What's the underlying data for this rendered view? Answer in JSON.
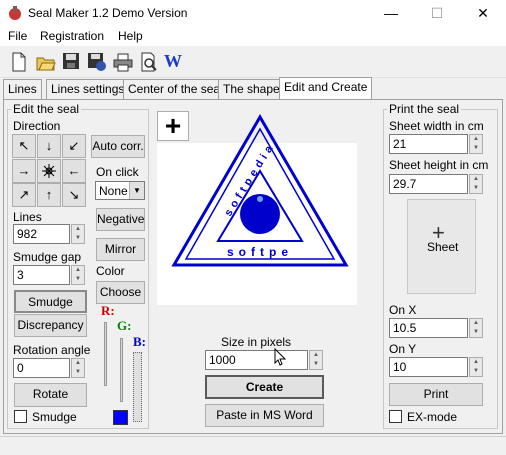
{
  "window": {
    "title": "Seal Maker 1.2 Demo Version",
    "minimize": "—",
    "maximize": "☐",
    "close": "✕"
  },
  "menu": [
    "File",
    "Registration",
    "Help"
  ],
  "toolbar": {
    "w_label": "W"
  },
  "tabs": [
    "Lines",
    "Lines settings",
    "Center of the seal",
    "The shape",
    "Edit and Create"
  ],
  "edit": {
    "group_title": "Edit the seal",
    "direction_label": "Direction",
    "auto_corr": "Auto corr.",
    "on_click_label": "On click",
    "on_click_value": "None",
    "lines_label": "Lines",
    "lines_value": "982",
    "negative": "Negative",
    "mirror": "Mirror",
    "smudge_gap_label": "Smudge gap",
    "smudge_gap_value": "3",
    "color_label": "Color",
    "choose": "Choose",
    "smudge_btn": "Smudge",
    "discrepancy": "Discrepancy",
    "r_label": "R:",
    "g_label": "G:",
    "b_label": "B:",
    "rotation_label": "Rotation angle",
    "rotation_value": "0",
    "rotate": "Rotate",
    "smudge_check": "Smudge",
    "color_swatch": "#0000ff"
  },
  "center": {
    "plus": "+",
    "seal_text_outer": "softpedia",
    "seal_text_inner": "softpe",
    "seal_color": "#0000cc",
    "size_label": "Size in pixels",
    "size_value": "1000",
    "create": "Create",
    "paste": "Paste in MS Word"
  },
  "print": {
    "group_title": "Print the seal",
    "sheet_width_label": "Sheet width in cm",
    "sheet_width_value": "21",
    "sheet_height_label": "Sheet height in cm",
    "sheet_height_value": "29.7",
    "sheet_label": "Sheet",
    "sheet_plus": "+",
    "on_x_label": "On X",
    "on_x_value": "10.5",
    "on_y_label": "On Y",
    "on_y_value": "10",
    "print_btn": "Print",
    "ex_mode": "EX-mode"
  }
}
